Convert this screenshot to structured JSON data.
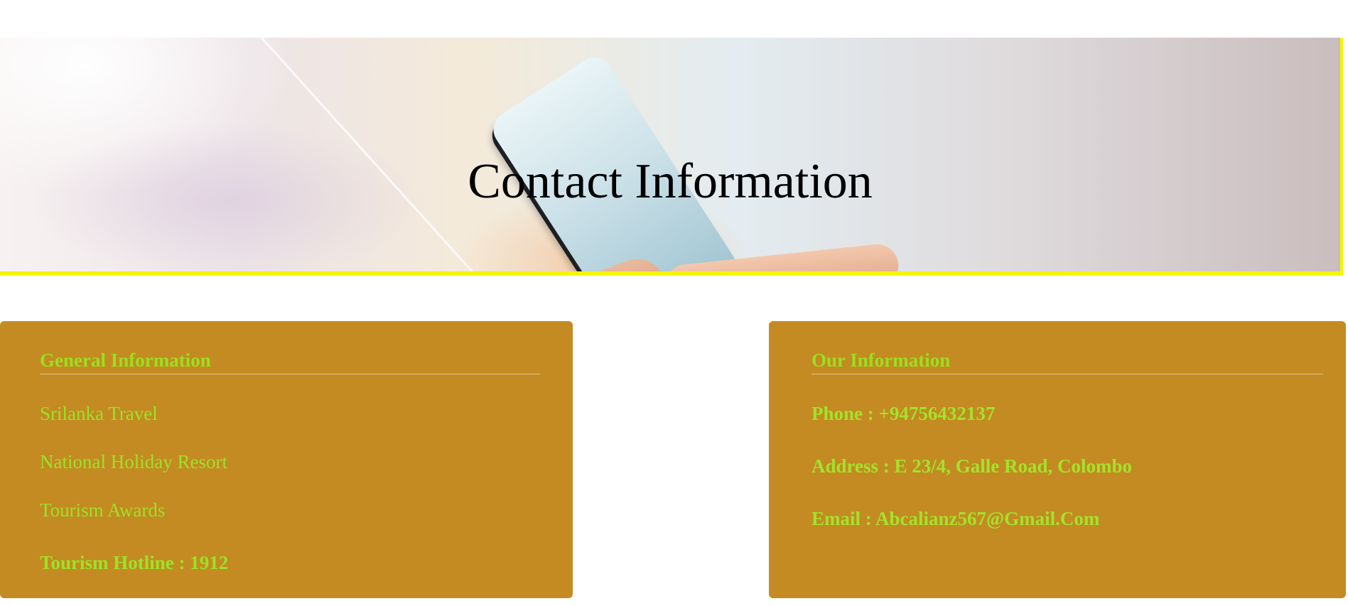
{
  "hero": {
    "title": "Contact Information",
    "image": "hands holding smartphone"
  },
  "general": {
    "heading": "General Information",
    "items": [
      "Srilanka Travel",
      "National Holiday Resort",
      "Tourism Awards"
    ],
    "hotline": "Tourism Hotline : 1912"
  },
  "ours": {
    "heading": "Our Information",
    "phone": "Phone : +94756432137",
    "address": "Address : E 23/4, Galle Road, Colombo",
    "email": "Email : Abcalianz567@Gmail.Com"
  },
  "colors": {
    "card_bg": "#c38b22",
    "text_green": "#99e01f",
    "hero_border": "#f5f500"
  }
}
